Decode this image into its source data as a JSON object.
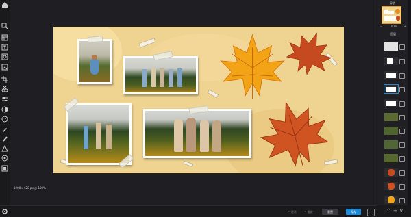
{
  "canvas": {
    "size_label": "1200 x 628 px @ 100%",
    "background_color": "#efd391"
  },
  "toolbar": {
    "tools": [
      "home-icon",
      "select-icon",
      "layout-icon",
      "text-icon",
      "image-icon",
      "photo-icon",
      "crop-icon",
      "cut-icon",
      "adjust-icon",
      "contrast-icon",
      "filter-icon",
      "brush-icon",
      "fill-icon",
      "shape-icon",
      "sticker-icon",
      "layers-icon",
      "settings-icon"
    ]
  },
  "status": {
    "undo_label": "↶ 撤消",
    "redo_label": "↷ 重做",
    "done_label": "重置",
    "next_label": "保存",
    "toggle_label": "|"
  },
  "right_panel": {
    "navigator_label": "导航",
    "zoom_value": "100%",
    "zoom_minus": "−",
    "zoom_plus": "+",
    "layers_label": "图层",
    "bottom_icons": [
      "^",
      "+",
      "v"
    ]
  },
  "colors": {
    "accent": "#1d8ad8",
    "selection": "#e69a2a",
    "leaf_orange": "#f2a316",
    "leaf_red": "#c64a1f"
  }
}
